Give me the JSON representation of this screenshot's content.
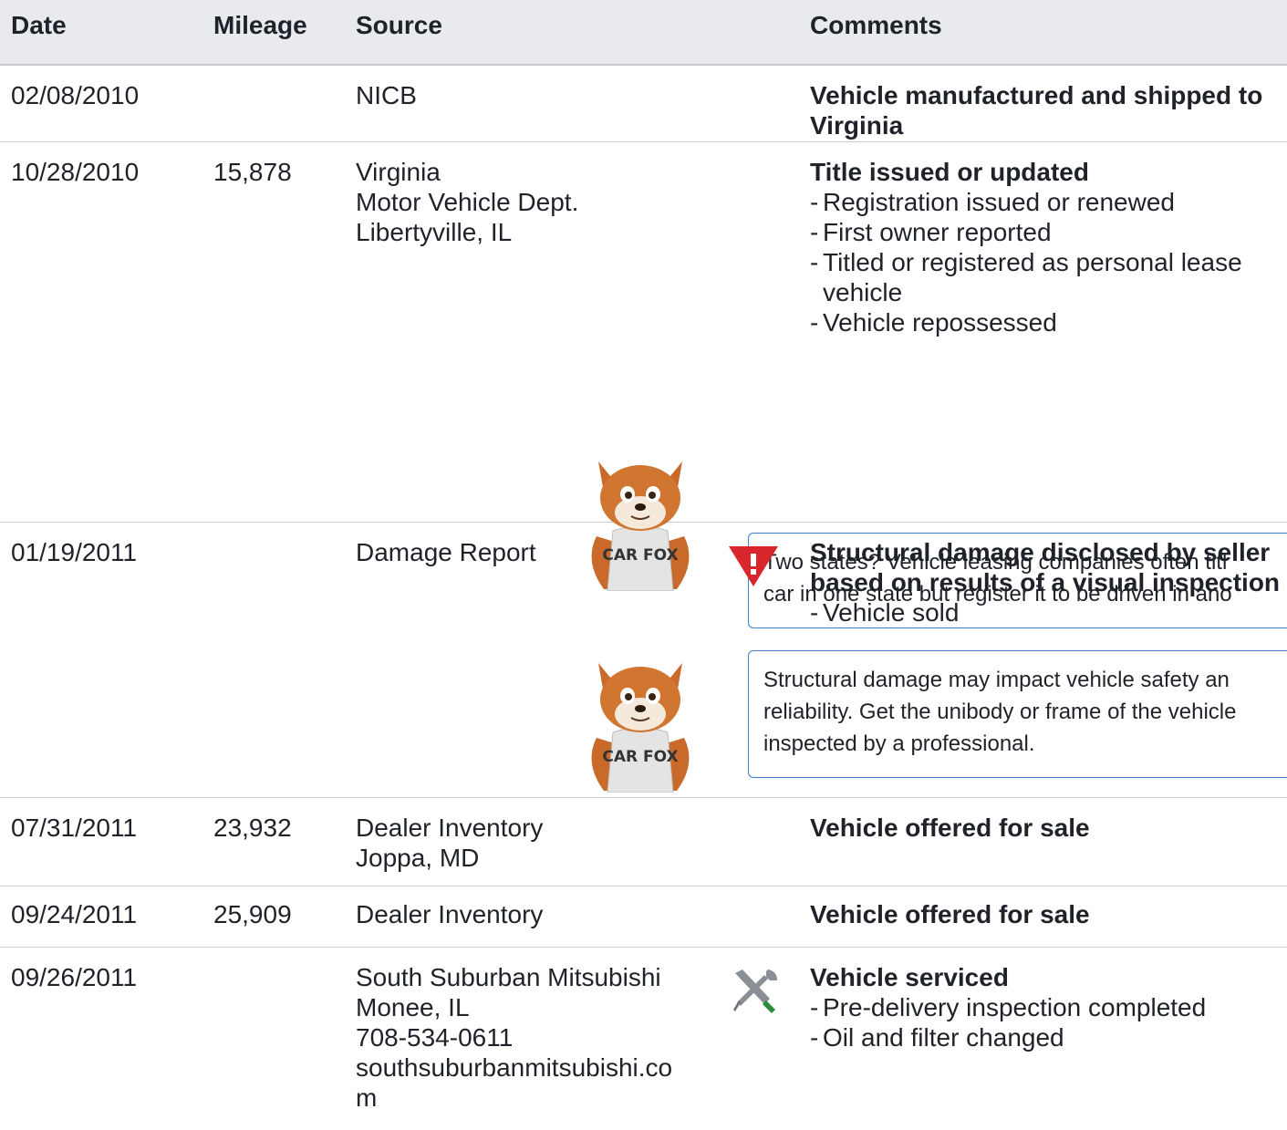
{
  "header": {
    "date": "Date",
    "mileage": "Mileage",
    "source": "Source",
    "comments": "Comments"
  },
  "rows": [
    {
      "date": "02/08/2010",
      "mileage": "",
      "source": [
        "NICB"
      ],
      "title": [
        "Vehicle manufactured and shipped to",
        "Virginia"
      ],
      "details": []
    },
    {
      "date": "10/28/2010",
      "mileage": "15,878",
      "source": [
        "Virginia",
        "Motor Vehicle Dept.",
        "Libertyville, IL"
      ],
      "title": [
        "Title issued or updated"
      ],
      "details": [
        "Registration issued or renewed",
        "First owner reported",
        "Titled or registered as personal lease",
        "vehicle",
        "Vehicle repossessed"
      ],
      "tip": [
        "Two states? Vehicle leasing companies often titl",
        "car in one state but register it to be driven in ano"
      ],
      "fox_label": "CAR FOX"
    },
    {
      "date": "01/19/2011",
      "mileage": "",
      "source": [
        "Damage Report"
      ],
      "icon": "alert-triangle-icon",
      "title": [
        "Structural damage disclosed by seller",
        "based on results of a visual inspection"
      ],
      "details": [
        "Vehicle sold"
      ],
      "tip": [
        "Structural damage may impact vehicle safety an",
        "reliability. Get the unibody or frame of the vehicle",
        "inspected by a professional."
      ],
      "fox_label": "CAR FOX"
    },
    {
      "date": "07/31/2011",
      "mileage": "23,932",
      "source": [
        "Dealer Inventory",
        "Joppa, MD"
      ],
      "title": [
        "Vehicle offered for sale"
      ],
      "details": []
    },
    {
      "date": "09/24/2011",
      "mileage": "25,909",
      "source": [
        "Dealer Inventory"
      ],
      "title": [
        "Vehicle offered for sale"
      ],
      "details": []
    },
    {
      "date": "09/26/2011",
      "mileage": "",
      "source": [
        "South Suburban Mitsubishi",
        "Monee, IL",
        "708-534-0611",
        "southsuburbanmitsubishi.co",
        "m"
      ],
      "icon": "tools-icon",
      "title": [
        "Vehicle serviced"
      ],
      "details": [
        "Pre-delivery inspection completed",
        "Oil and filter changed"
      ]
    }
  ],
  "colors": {
    "alert": "#d9262c",
    "tip_border": "#3b7fd1",
    "header_bg": "#e9eaee",
    "wrench_handle": "#2e8b3a"
  }
}
